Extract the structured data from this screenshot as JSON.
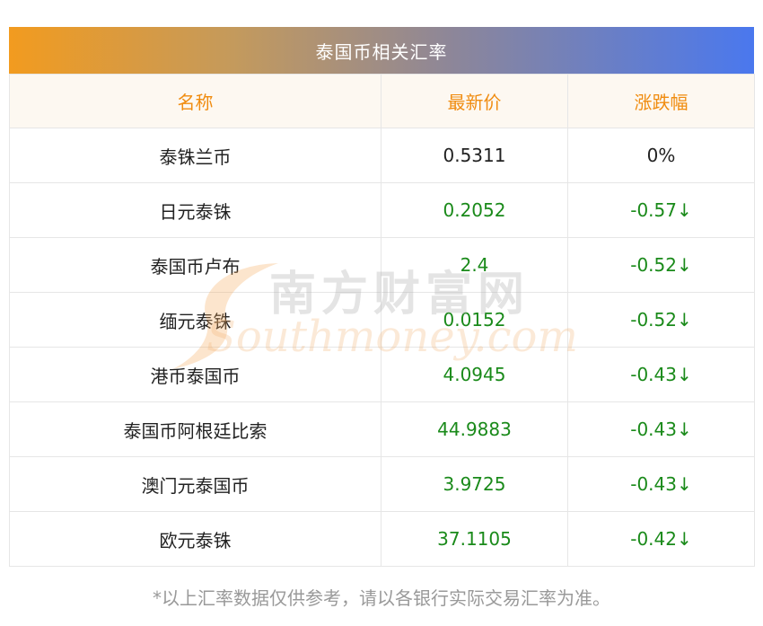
{
  "title": "泰国币相关汇率",
  "headers": [
    "名称",
    "最新价",
    "涨跌幅"
  ],
  "rows": [
    {
      "name": "泰铢兰币",
      "price": "0.5311",
      "change": "0%"
    },
    {
      "name": "日元泰铢",
      "price": "0.2052",
      "change": "-0.57↓"
    },
    {
      "name": "泰国币卢布",
      "price": "2.4",
      "change": "-0.52↓"
    },
    {
      "name": "缅元泰铢",
      "price": "0.0152",
      "change": "-0.52↓"
    },
    {
      "name": "港币泰国币",
      "price": "4.0945",
      "change": "-0.43↓"
    },
    {
      "name": "泰国币阿根廷比索",
      "price": "44.9883",
      "change": "-0.43↓"
    },
    {
      "name": "澳门元泰国币",
      "price": "3.9725",
      "change": "-0.43↓"
    },
    {
      "name": "欧元泰铢",
      "price": "37.1105",
      "change": "-0.42↓"
    }
  ],
  "footnote": "*以上汇率数据仅供参考，请以各银行实际交易汇率为准。",
  "watermark": {
    "cn": "南方财富网",
    "en": "Southmoney.com"
  },
  "colors": {
    "header_text": "#f08c10",
    "down": "#1a8a1a",
    "neutral": "#222222",
    "title_gradient_start": "#f29b1f",
    "title_gradient_end": "#4a78ee"
  }
}
